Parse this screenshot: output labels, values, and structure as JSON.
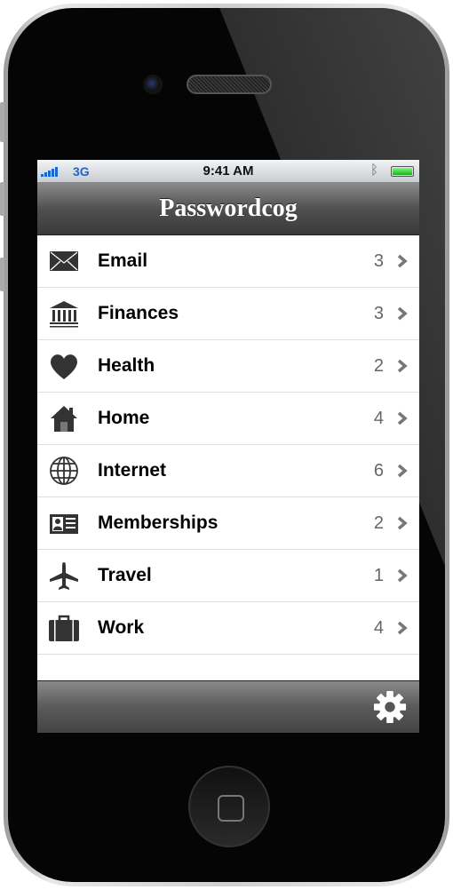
{
  "status_bar": {
    "carrier": "3G",
    "time": "9:41 AM",
    "signal_bars": 5,
    "battery_level": 1.0,
    "bluetooth": true
  },
  "nav": {
    "title": "Passwordcog"
  },
  "categories": [
    {
      "label": "Email",
      "count": "3",
      "icon": "envelope-icon"
    },
    {
      "label": "Finances",
      "count": "3",
      "icon": "bank-icon"
    },
    {
      "label": "Health",
      "count": "2",
      "icon": "heart-icon"
    },
    {
      "label": "Home",
      "count": "4",
      "icon": "house-icon"
    },
    {
      "label": "Internet",
      "count": "6",
      "icon": "globe-icon"
    },
    {
      "label": "Memberships",
      "count": "2",
      "icon": "id-card-icon"
    },
    {
      "label": "Travel",
      "count": "1",
      "icon": "airplane-icon"
    },
    {
      "label": "Work",
      "count": "4",
      "icon": "briefcase-icon"
    }
  ],
  "footer": {
    "settings_icon": "gear-icon"
  },
  "colors": {
    "accent": "#1a66cc",
    "battery": "#2a2"
  }
}
